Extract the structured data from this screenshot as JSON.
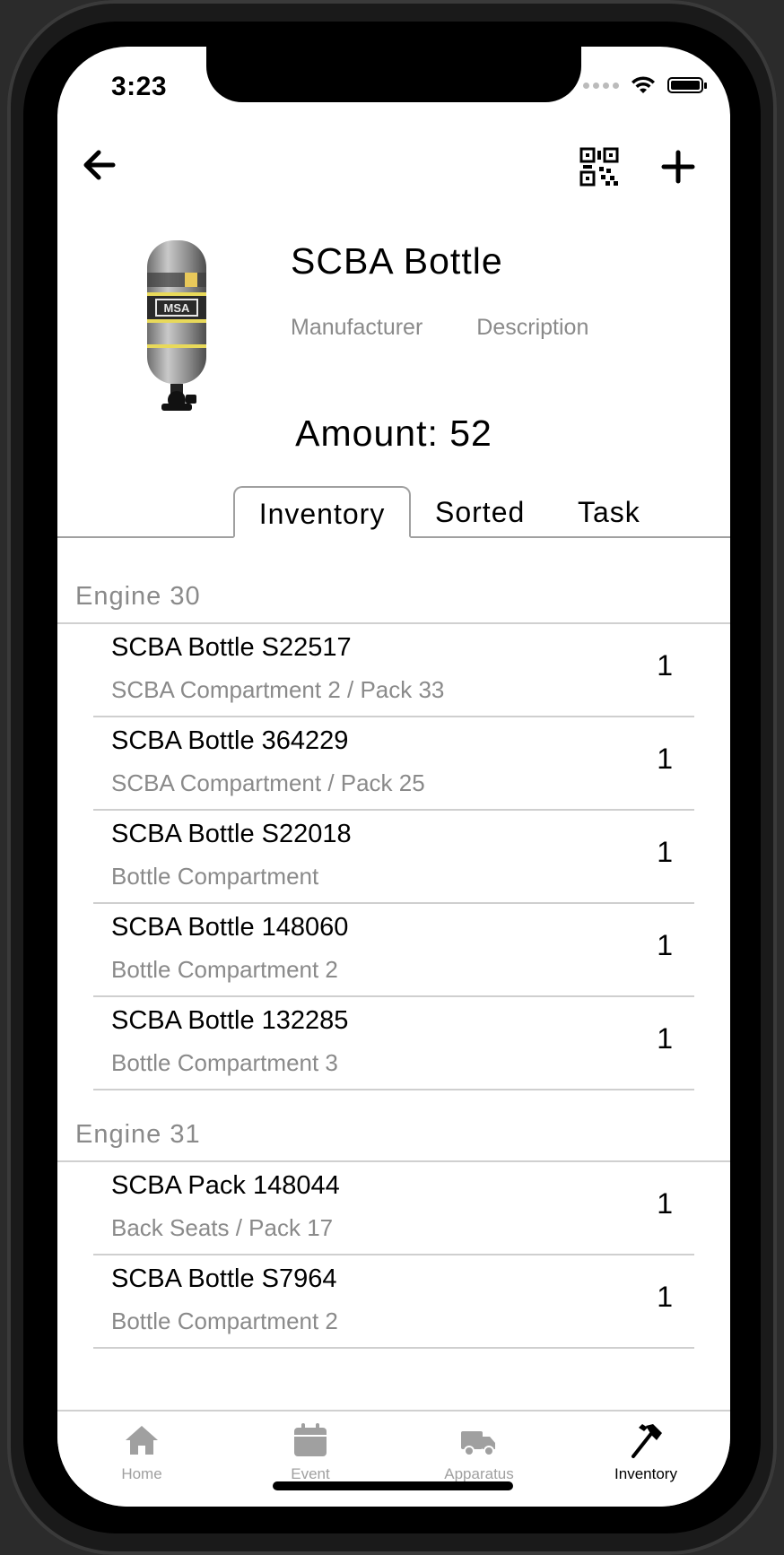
{
  "status": {
    "time": "3:23"
  },
  "product": {
    "title": "SCBA Bottle",
    "manufacturer_label": "Manufacturer",
    "description_label": "Description",
    "amount_label": "Amount: 52"
  },
  "tabs": [
    {
      "label": "Inventory",
      "active": true
    },
    {
      "label": "Sorted",
      "active": false
    },
    {
      "label": "Task",
      "active": false
    }
  ],
  "sections": [
    {
      "title": "Engine 30",
      "items": [
        {
          "title": "SCBA Bottle S22517",
          "location": "SCBA Compartment 2 / Pack 33",
          "count": "1"
        },
        {
          "title": "SCBA Bottle 364229",
          "location": "SCBA Compartment / Pack 25",
          "count": "1"
        },
        {
          "title": "SCBA Bottle S22018",
          "location": "Bottle Compartment",
          "count": "1"
        },
        {
          "title": "SCBA Bottle 148060",
          "location": "Bottle Compartment 2",
          "count": "1"
        },
        {
          "title": "SCBA Bottle 132285",
          "location": "Bottle Compartment 3",
          "count": "1"
        }
      ]
    },
    {
      "title": "Engine 31",
      "items": [
        {
          "title": "SCBA Pack 148044",
          "location": "Back Seats / Pack 17",
          "count": "1"
        },
        {
          "title": "SCBA Bottle S7964",
          "location": "Bottle Compartment 2",
          "count": "1"
        }
      ]
    }
  ],
  "tabbar": [
    {
      "label": "Home",
      "icon": "home-icon",
      "active": false
    },
    {
      "label": "Event",
      "icon": "calendar-icon",
      "active": false
    },
    {
      "label": "Apparatus",
      "icon": "truck-icon",
      "active": false
    },
    {
      "label": "Inventory",
      "icon": "axe-icon",
      "active": true
    }
  ],
  "colors": {
    "inactive": "#a0a0a0",
    "active": "#000000",
    "muted_text": "#8a8a8a"
  }
}
